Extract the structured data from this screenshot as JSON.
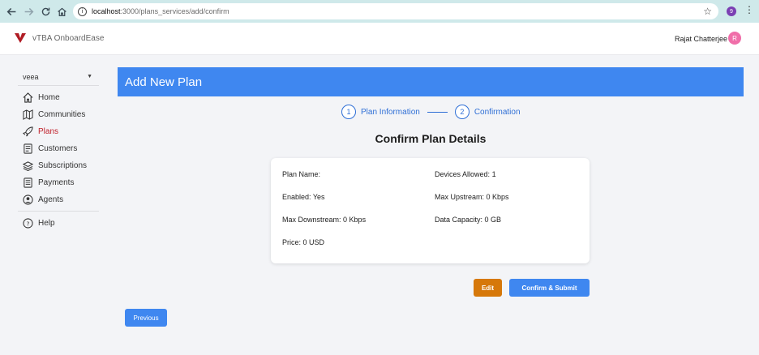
{
  "browser": {
    "url_host": "localhost",
    "url_path": ":3000/plans_services/add/confirm",
    "profile_initial": "9"
  },
  "app": {
    "brand": "vTBA OnboardEase",
    "user_name": "Rajat Chatterjee",
    "user_initial": "R",
    "colors": {
      "primary": "#3f87f0",
      "active": "#c0202a",
      "edit": "#d6780a",
      "avatar": "#f06ea9"
    }
  },
  "sidebar": {
    "org": "veea",
    "items": [
      {
        "label": "Home",
        "icon": "home-icon"
      },
      {
        "label": "Communities",
        "icon": "map-icon"
      },
      {
        "label": "Plans",
        "icon": "rocket-icon",
        "active": true
      },
      {
        "label": "Customers",
        "icon": "customers-icon"
      },
      {
        "label": "Subscriptions",
        "icon": "layers-icon"
      },
      {
        "label": "Payments",
        "icon": "receipt-icon"
      },
      {
        "label": "Agents",
        "icon": "agent-icon"
      }
    ],
    "help": "Help"
  },
  "main": {
    "banner_title": "Add New Plan",
    "steps": [
      {
        "number": "1",
        "label": "Plan Information"
      },
      {
        "number": "2",
        "label": "Confirmation"
      }
    ],
    "confirm_title": "Confirm Plan Details",
    "fields": {
      "plan_name_label": "Plan Name:",
      "plan_name_value": "",
      "devices_label": "Devices Allowed:",
      "devices_value": "1",
      "enabled_label": "Enabled:",
      "enabled_value": "Yes",
      "upstream_label": "Max Upstream:",
      "upstream_value": "0 Kbps",
      "downstream_label": "Max Downstream:",
      "downstream_value": "0 Kbps",
      "capacity_label": "Data Capacity:",
      "capacity_value": "0 GB",
      "price_label": "Price:",
      "price_value": "0 USD"
    },
    "buttons": {
      "edit": "Edit",
      "submit": "Confirm & Submit",
      "previous": "Previous"
    }
  }
}
